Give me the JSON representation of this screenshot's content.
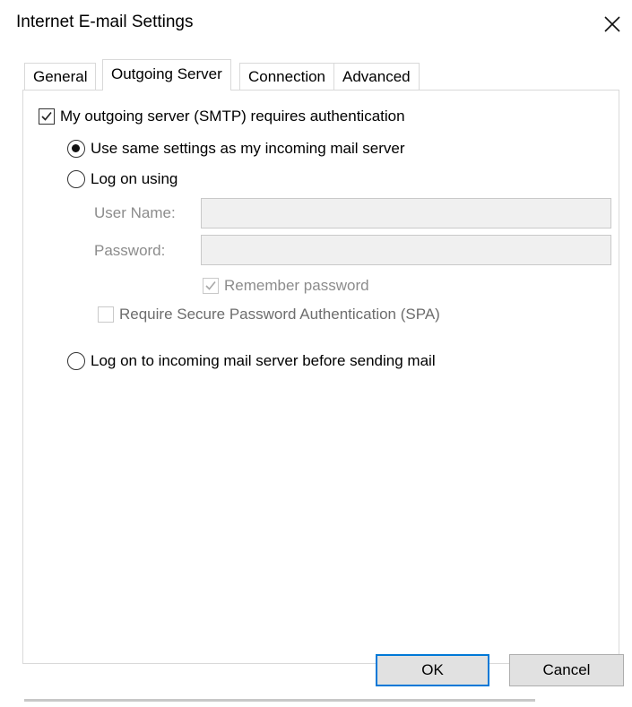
{
  "window": {
    "title": "Internet E-mail Settings"
  },
  "tabs": [
    {
      "label": "General"
    },
    {
      "label": "Outgoing Server"
    },
    {
      "label": "Connection"
    },
    {
      "label": "Advanced"
    }
  ],
  "active_tab": "Outgoing Server",
  "outgoing": {
    "requires_auth_label": "My outgoing server (SMTP) requires authentication",
    "requires_auth_checked": true,
    "same_settings_label": "Use same settings as my incoming mail server",
    "same_settings_selected": true,
    "log_on_using_label": "Log on using",
    "log_on_using_selected": false,
    "user_name_label": "User Name:",
    "user_name_value": "",
    "password_label": "Password:",
    "password_value": "",
    "remember_password_label": "Remember password",
    "remember_password_checked": true,
    "spa_label": "Require Secure Password Authentication (SPA)",
    "spa_checked": false,
    "log_on_incoming_label": "Log on to incoming mail server before sending mail",
    "log_on_incoming_selected": false
  },
  "buttons": {
    "ok": "OK",
    "cancel": "Cancel"
  },
  "icons": {
    "close": "close-icon",
    "check": "checkmark-icon"
  },
  "colors": {
    "accent": "#0078d7",
    "disabled_text": "#8c8c8c",
    "disabled_field": "#f0f0f0"
  }
}
